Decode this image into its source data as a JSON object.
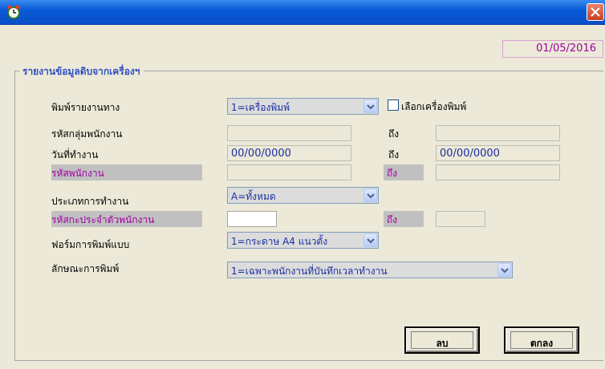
{
  "window": {
    "title": ""
  },
  "date": "01/05/2016",
  "group_title": "รายงานข้อมูลดิบจากเครื่องฯ",
  "rows": {
    "print_via": {
      "label": "พิมพ์รายงานทาง",
      "value": "1=เครื่องพิมพ์",
      "checkbox_label": "เลือกเครื่องพิมพ์"
    },
    "employee_group": {
      "label": "รหัสกลุ่มพนักงาน",
      "from": "",
      "to_label": "ถึง",
      "to": ""
    },
    "work_date": {
      "label": "วันที่ทำงาน",
      "from": "00/00/0000",
      "to_label": "ถึง",
      "to": "00/00/0000"
    },
    "employee_code": {
      "label": "รหัสพนักงาน",
      "from": "",
      "to_label": "ถึง",
      "to": ""
    },
    "work_type": {
      "label": "ประเภทการทำงาน",
      "value": "A=ทั้งหมด"
    },
    "employee_id": {
      "label": "รหัสกะประจำตัวพนักงาน",
      "from": "",
      "to_label": "ถึง",
      "to": ""
    },
    "print_form": {
      "label": "ฟอร์มการพิมพ์แบบ",
      "value": "1=กระดาษ A4 แนวตั้ง"
    },
    "print_style": {
      "label": "ลักษณะการพิมพ์",
      "value": "1=เฉพาะพนักงานที่บันทึกเวลาทำงาน"
    }
  },
  "buttons": {
    "delete": "ลบ",
    "ok": "ตกลง"
  },
  "colors": {
    "titlebar": "#0a5ad8",
    "highlight_label": "#a000a0",
    "value_text": "#1b2fa0"
  }
}
